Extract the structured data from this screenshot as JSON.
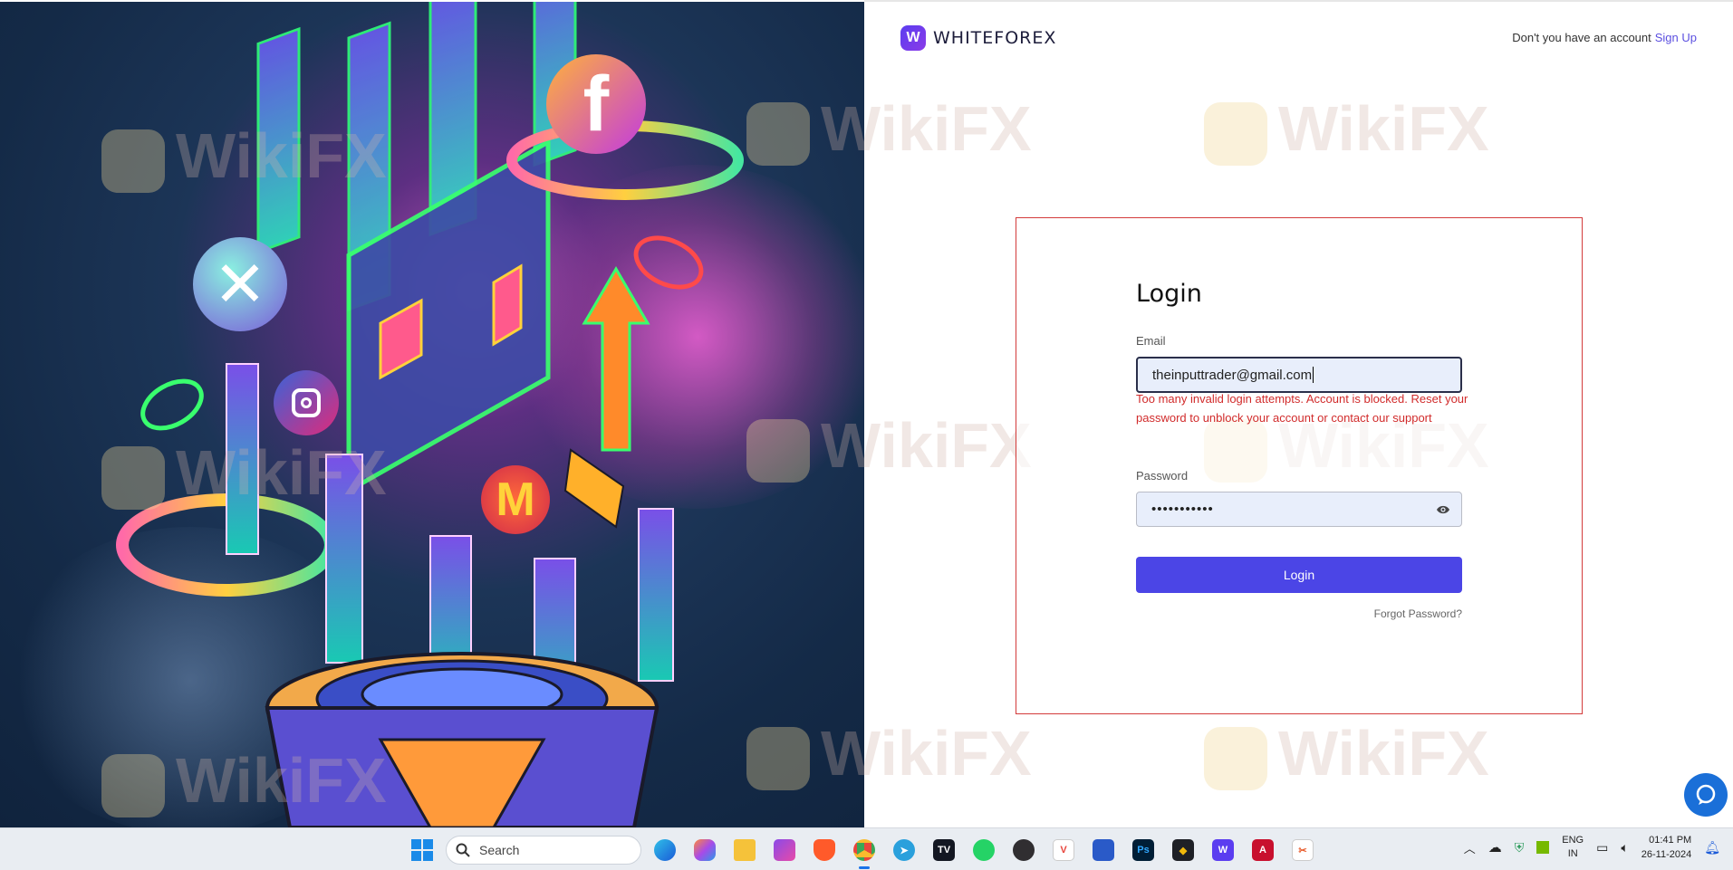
{
  "brand": {
    "name": "WHITEFOREX",
    "mark": "W"
  },
  "header": {
    "signup_prompt": "Don't you have an account",
    "signup_link": "Sign Up"
  },
  "watermark": "WikiFX",
  "login": {
    "title": "Login",
    "email_label": "Email",
    "email_value": "theinputtrader@gmail.com",
    "error_message": "Too many invalid login attempts. Account is blocked. Reset your password to unblock your account or contact our support",
    "password_label": "Password",
    "password_value": "•••••••••••",
    "submit_label": "Login",
    "forgot_label": "Forgot Password?"
  },
  "colors": {
    "accent": "#4b45e6",
    "error": "#d12b2b",
    "link": "#5b4fe0"
  },
  "taskbar": {
    "search_placeholder": "Search",
    "apps": [
      "windows-start",
      "edge",
      "copilot",
      "file-explorer",
      "clipchamp",
      "brave",
      "chrome",
      "telegram",
      "tradingview",
      "whatsapp",
      "obs",
      "vivaldi",
      "remote-app",
      "photoshop",
      "binance",
      "whiteforex",
      "pdf-reader",
      "snipping-tool"
    ],
    "language": "ENG",
    "region": "IN",
    "time": "01:41 PM",
    "date": "26-11-2024"
  }
}
